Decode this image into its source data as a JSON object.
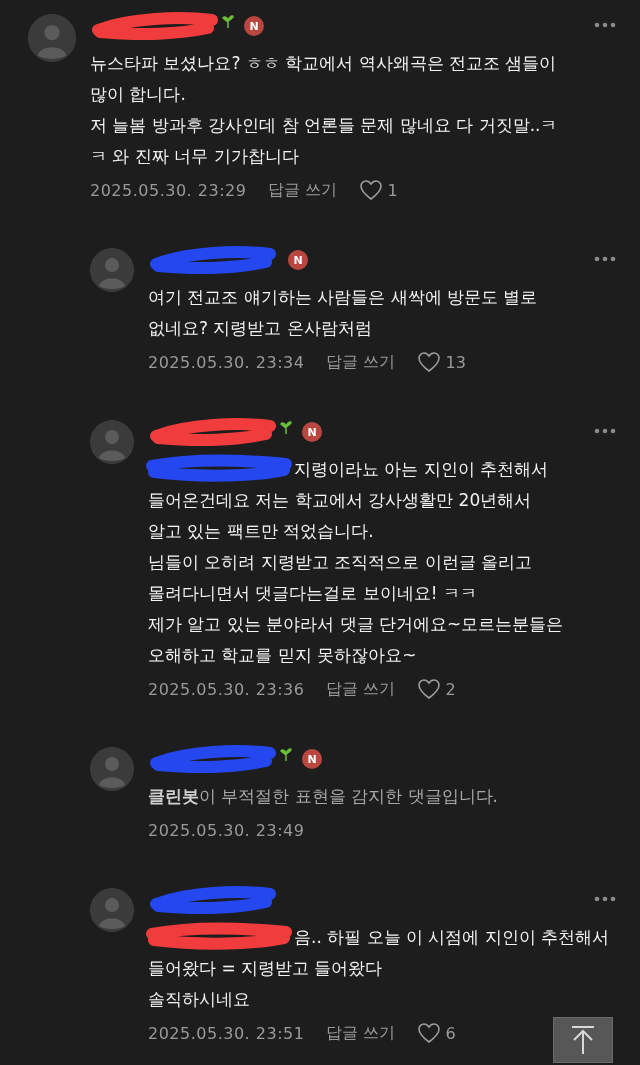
{
  "comments": [
    {
      "reply": false,
      "name_mark": {
        "color": "#f03c3c"
      },
      "sprout": true,
      "badge": "N",
      "more_menu": true,
      "filtered": false,
      "body": "뉴스타파 보셨나요? ㅎㅎ 학교에서 역사왜곡은 전교조 샘들이\n많이 합니다.\n저 늘봄 방과후 강사인데 참 언론들 문제 많네요 다 거짓말..ㅋㅋ 와 진짜 너무 기가찹니다",
      "date": "2025.05.30. 23:29",
      "reply_link": "답글 쓰기",
      "likes": "1"
    },
    {
      "reply": true,
      "name_mark": {
        "color": "#2447f0"
      },
      "sprout": false,
      "badge": "N",
      "more_menu": true,
      "filtered": false,
      "body": "여기 전교조 얘기하는 사람들은 새싹에 방문도 별로\n없네요? 지령받고 온사람처럼",
      "date": "2025.05.30. 23:34",
      "reply_link": "답글 쓰기",
      "likes": "13"
    },
    {
      "reply": true,
      "name_mark": {
        "color": "#f03c3c"
      },
      "sprout": true,
      "badge": "N",
      "more_menu": true,
      "filtered": false,
      "mention_mark": {
        "color": "#2447f0"
      },
      "body": "지령이라뇨 아는 지인이 추천해서\n들어온건데요 저는 학교에서 강사생활만 20년해서\n알고 있는 팩트만 적었습니다.\n님들이 오히려 지령받고 조직적으로 이런글 올리고\n몰려다니면서 댓글다는걸로 보이네요! ㅋㅋ\n제가 알고 있는 분야라서 댓글 단거에요~모르는분들은\n오해하고 학교를 믿지 못하잖아요~",
      "date": "2025.05.30. 23:36",
      "reply_link": "답글 쓰기",
      "likes": "2"
    },
    {
      "reply": true,
      "name_mark": {
        "color": "#2447f0"
      },
      "sprout": true,
      "badge": "N",
      "more_menu": false,
      "filtered": true,
      "body": "**클린봇**이 부적절한 표현을 감지한 댓글입니다.",
      "date": "2025.05.30. 23:49"
    },
    {
      "reply": true,
      "name_mark": {
        "color": "#2447f0"
      },
      "sprout": false,
      "more_menu": true,
      "filtered": false,
      "mention_mark": {
        "color": "#f03c3c"
      },
      "body": "음.. 하필 오늘 이 시점에 지인이 추천해서\n들어왔다 = 지령받고 들어왔다\n솔직하시네요",
      "date": "2025.05.30. 23:51",
      "reply_link": "답글 쓰기",
      "likes": "6"
    }
  ]
}
